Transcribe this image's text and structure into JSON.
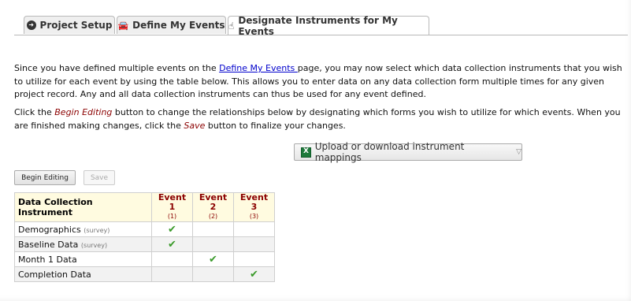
{
  "tabs": [
    {
      "label": "Project Setup",
      "icon": "arrow-circle-icon"
    },
    {
      "label": "Define My Events",
      "icon": "car-icon"
    },
    {
      "label": "Designate Instruments for My Events",
      "icon": "hand-pointer-icon"
    }
  ],
  "intro": {
    "part1": "Since you have defined multiple events on the ",
    "link": "Define My Events ",
    "part2": "page, you may now select which data collection instruments that you wish to utilize for each event by using the table below. This allows you to enter data on any data collection form multiple times for any given project record. Any and all data collection instruments can thus be used for any event defined."
  },
  "instructions": {
    "part1": "Click the ",
    "begin": "Begin Editing",
    "part2": " button to change the relationships below by designating which forms you wish to utilize for which events. When you are finished making changes, click the ",
    "save": "Save",
    "part3": " button to finalize your changes."
  },
  "upload_button": "Upload or download instrument mappings",
  "begin_editing": "Begin Editing",
  "save": "Save",
  "table": {
    "header": "Data Collection Instrument",
    "events": [
      {
        "name": "Event 1",
        "num": "(1)"
      },
      {
        "name": "Event 2",
        "num": "(2)"
      },
      {
        "name": "Event 3",
        "num": "(3)"
      }
    ],
    "rows": [
      {
        "name": "Demographics",
        "tag": "(survey)",
        "checks": [
          true,
          false,
          false
        ]
      },
      {
        "name": "Baseline Data",
        "tag": "(survey)",
        "checks": [
          true,
          false,
          false
        ]
      },
      {
        "name": "Month 1 Data",
        "tag": "",
        "checks": [
          false,
          true,
          false
        ]
      },
      {
        "name": "Completion Data",
        "tag": "",
        "checks": [
          false,
          false,
          true
        ]
      }
    ]
  },
  "colors": {
    "accent_text": "#8b0000",
    "link": "#0000cc",
    "check": "#3a9a2a",
    "header_bg": "#fffbe0"
  }
}
